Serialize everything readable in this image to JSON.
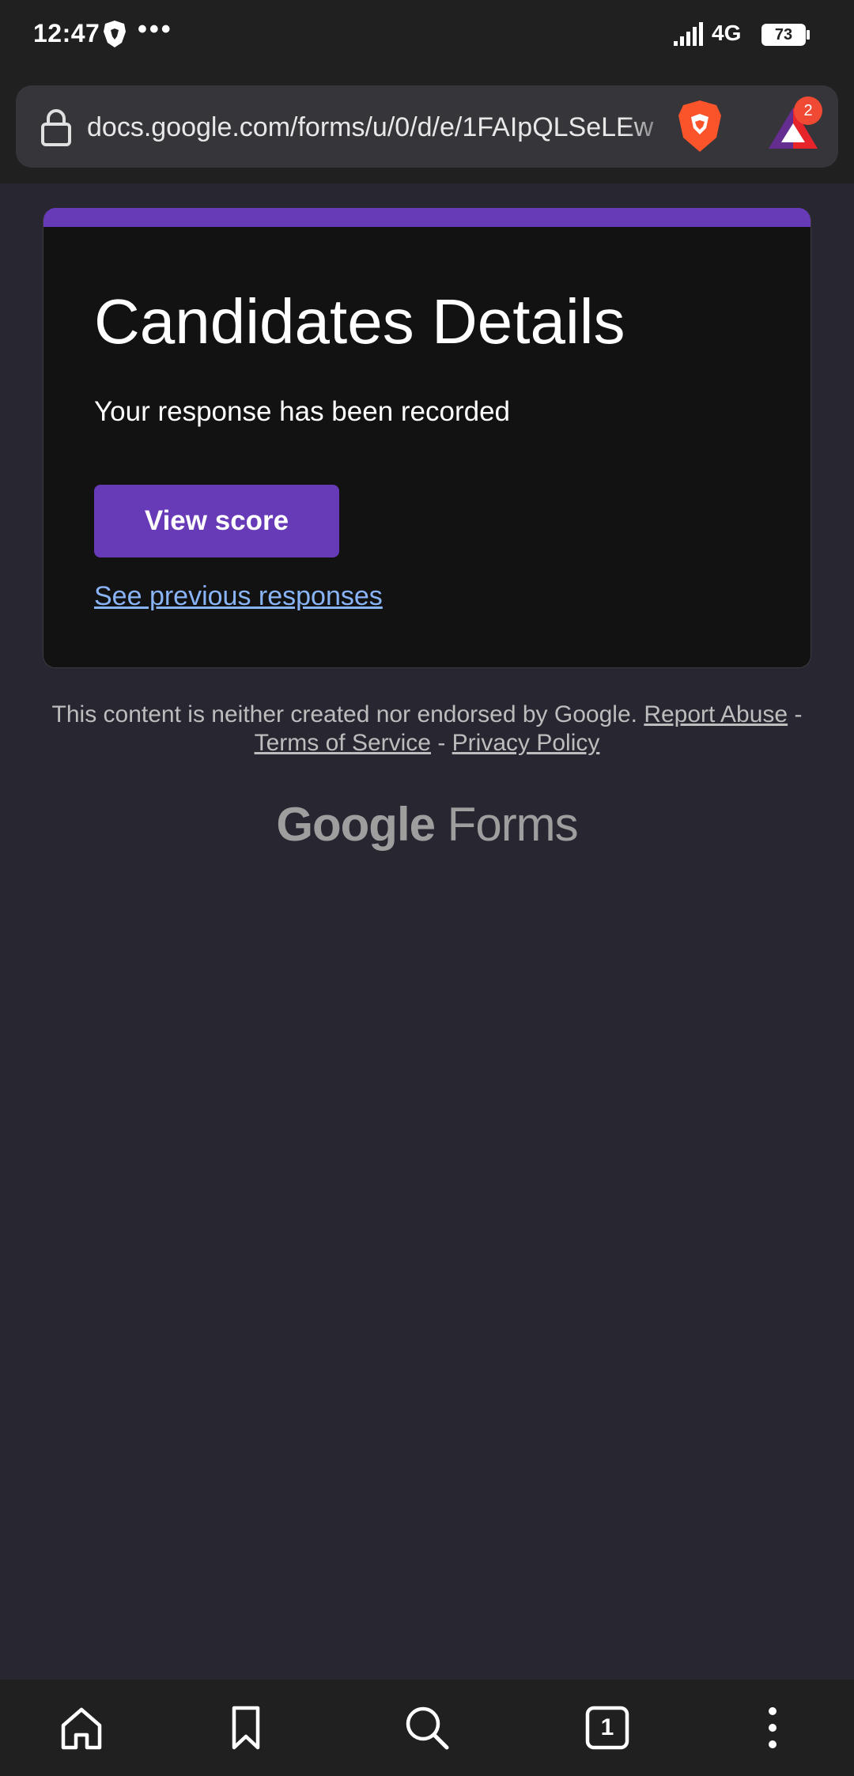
{
  "status_bar": {
    "time": "12:47",
    "more_dots": "•••",
    "network": "4G",
    "battery": "73"
  },
  "browser": {
    "url": "docs.google.com/forms/u/0/d/e/1FAIpQLSeLEw",
    "rewards_badge_count": "2"
  },
  "form": {
    "title": "Candidates Details",
    "confirmation": "Your response has been recorded",
    "view_score_label": "View score",
    "previous_responses_label": "See previous responses",
    "accent_color": "#673ab7"
  },
  "footer": {
    "disclaimer": "This content is neither created nor endorsed by Google.",
    "report_abuse": "Report Abuse",
    "separator": "-",
    "terms": "Terms of Service",
    "privacy": "Privacy Policy",
    "logo_google": "Google",
    "logo_forms": "Forms"
  },
  "bottom_nav": {
    "tab_count": "1",
    "items": [
      "home-icon",
      "bookmark-icon",
      "search-icon",
      "tabs-icon",
      "more-vertical-icon"
    ]
  }
}
